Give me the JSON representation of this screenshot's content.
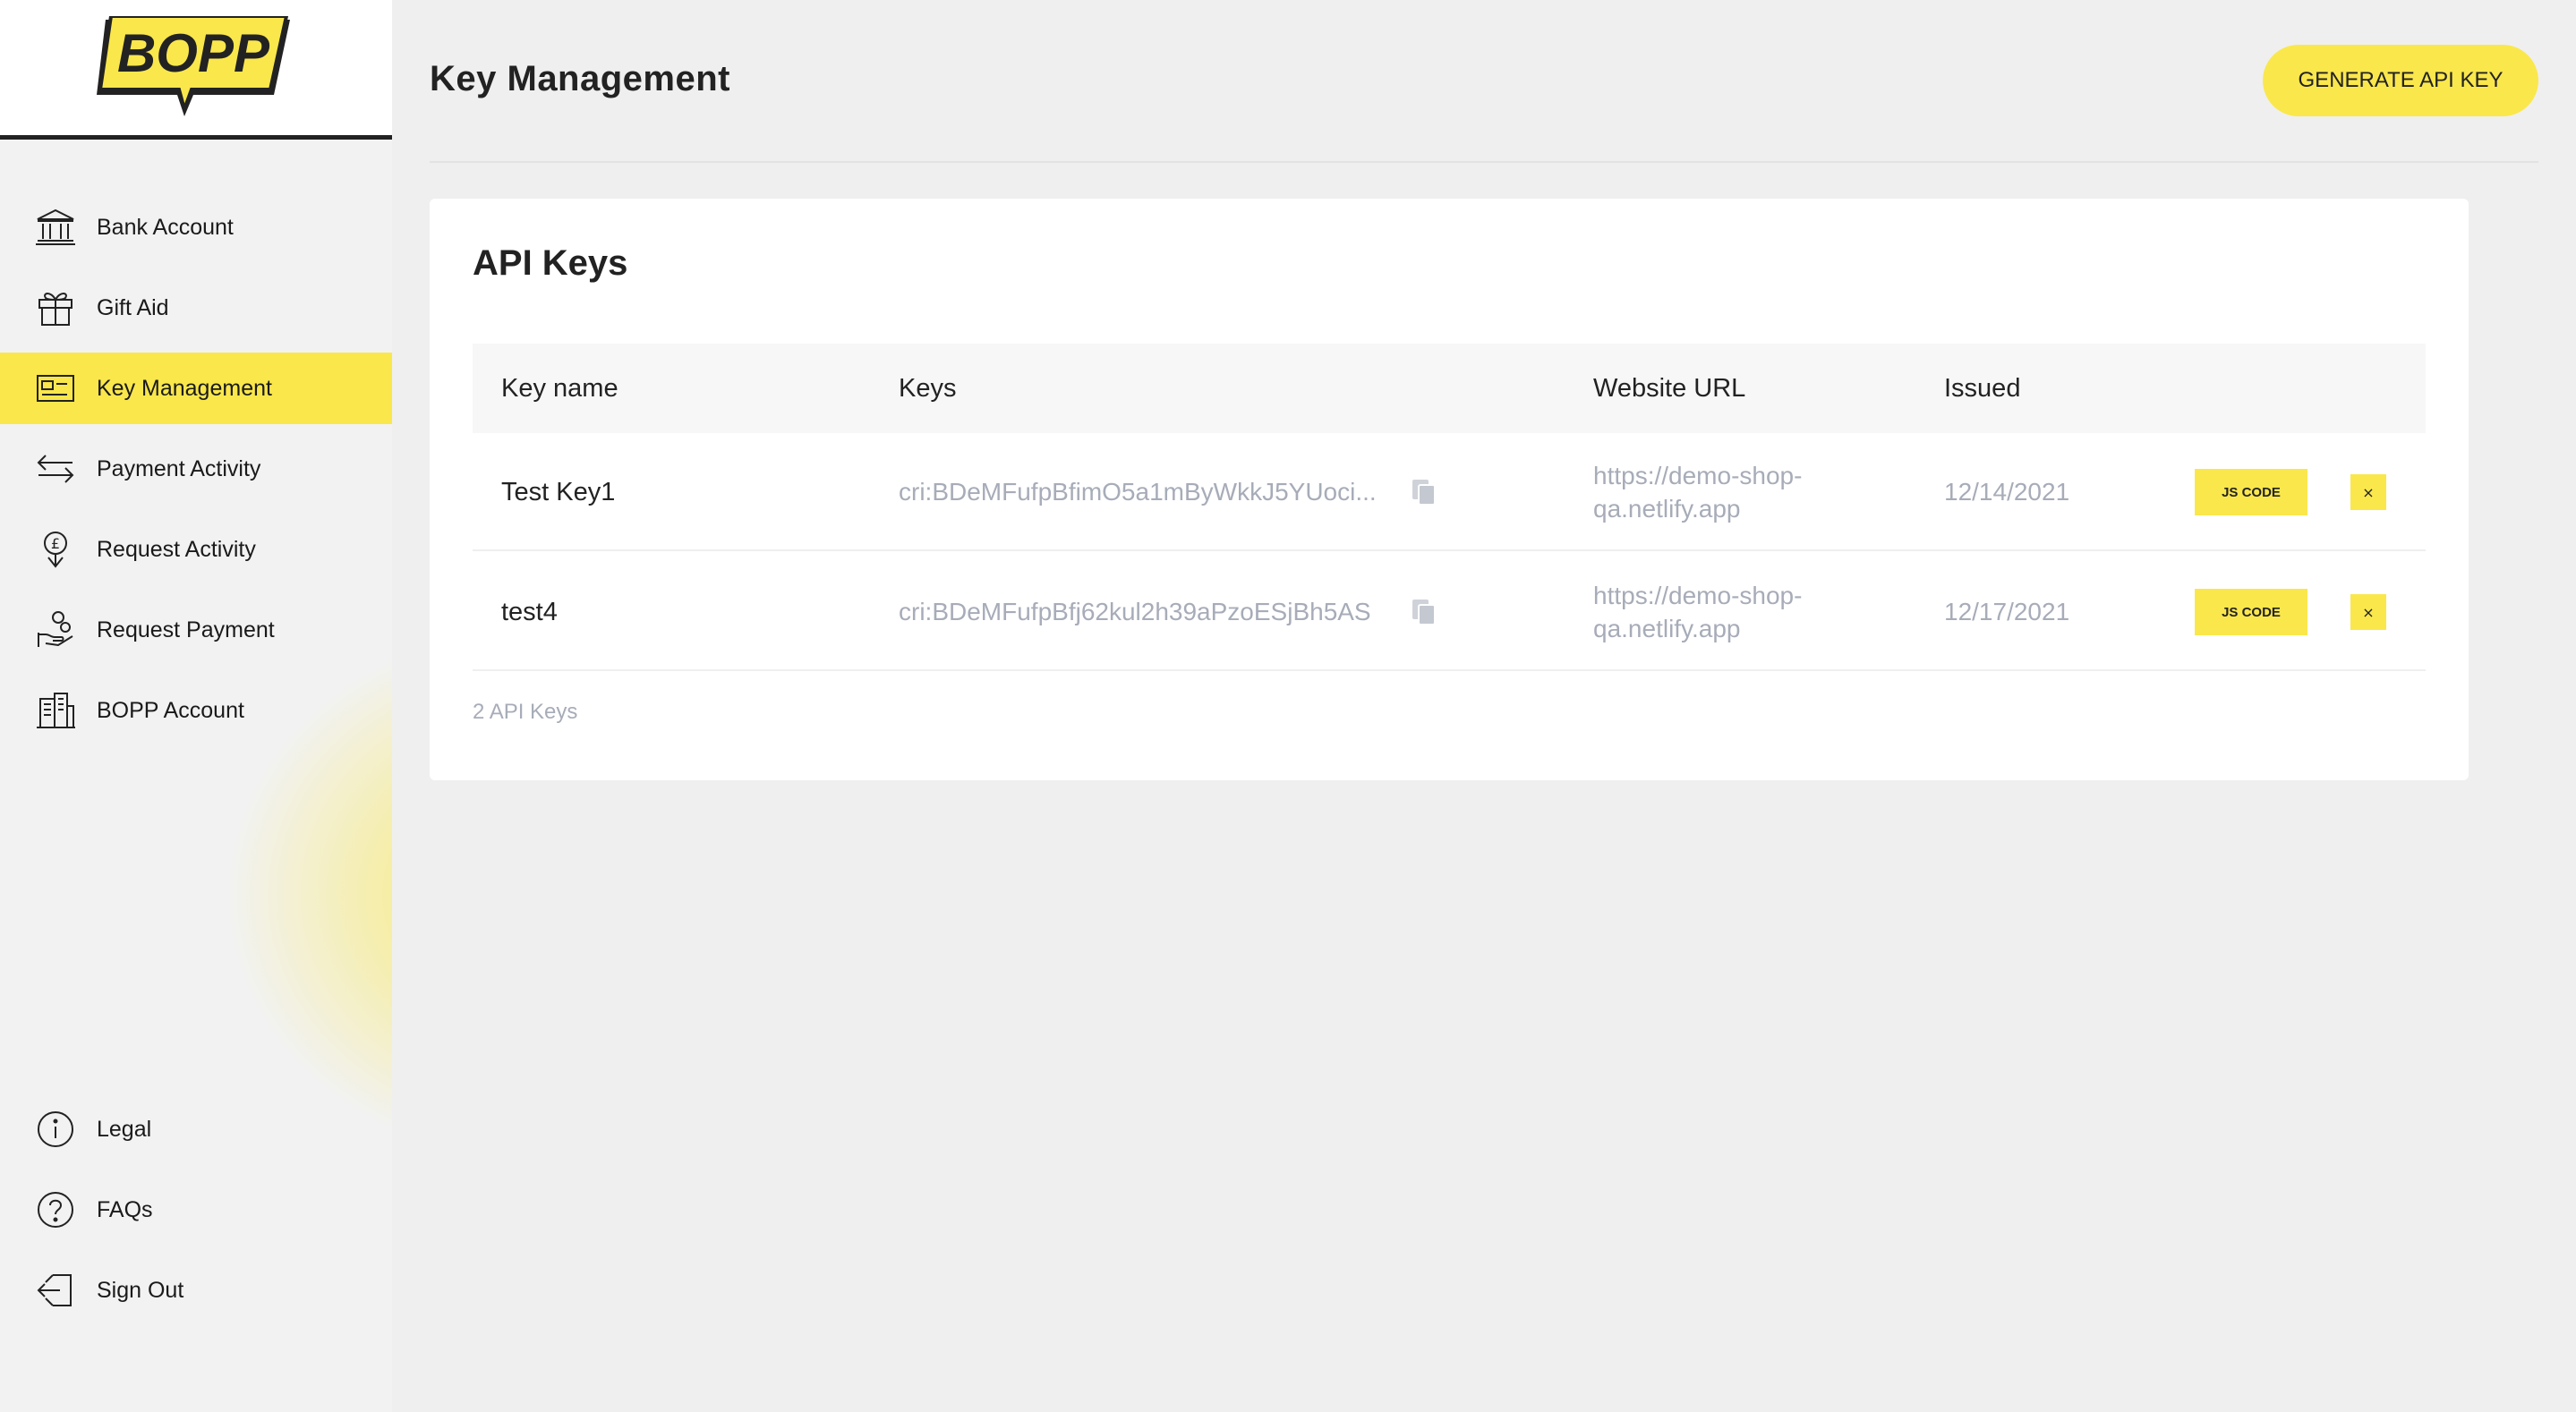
{
  "brand": {
    "logo_text": "BOPP",
    "accent_color": "#fae74c"
  },
  "sidebar": {
    "items": [
      {
        "label": "Bank Account",
        "icon": "bank-icon"
      },
      {
        "label": "Gift Aid",
        "icon": "gift-icon"
      },
      {
        "label": "Key Management",
        "icon": "key-card-icon",
        "active": true
      },
      {
        "label": "Payment Activity",
        "icon": "transfer-arrows-icon"
      },
      {
        "label": "Request Activity",
        "icon": "pound-pin-icon"
      },
      {
        "label": "Request Payment",
        "icon": "hand-coins-icon"
      },
      {
        "label": "BOPP Account",
        "icon": "buildings-icon"
      }
    ],
    "bottom_items": [
      {
        "label": "Legal",
        "icon": "info-icon"
      },
      {
        "label": "FAQs",
        "icon": "question-icon"
      },
      {
        "label": "Sign Out",
        "icon": "sign-out-icon"
      }
    ]
  },
  "header": {
    "title": "Key Management",
    "generate_button": "GENERATE API KEY"
  },
  "api_keys": {
    "title": "API Keys",
    "columns": [
      "Key name",
      "Keys",
      "Website URL",
      "Issued"
    ],
    "rows": [
      {
        "name": "Test Key1",
        "key": "cri:BDeMFufpBfimO5a1mByWkkJ5YUoci...",
        "url_line1": "https://demo-shop-",
        "url_line2": "qa.netlify.app",
        "issued": "12/14/2021",
        "js_button": "JS CODE",
        "delete_button": "×"
      },
      {
        "name": "test4",
        "key": "cri:BDeMFufpBfj62kul2h39aPzoESjBh5AS",
        "url_line1": "https://demo-shop-",
        "url_line2": "qa.netlify.app",
        "issued": "12/17/2021",
        "js_button": "JS CODE",
        "delete_button": "×"
      }
    ],
    "count_label": "2 API Keys"
  }
}
